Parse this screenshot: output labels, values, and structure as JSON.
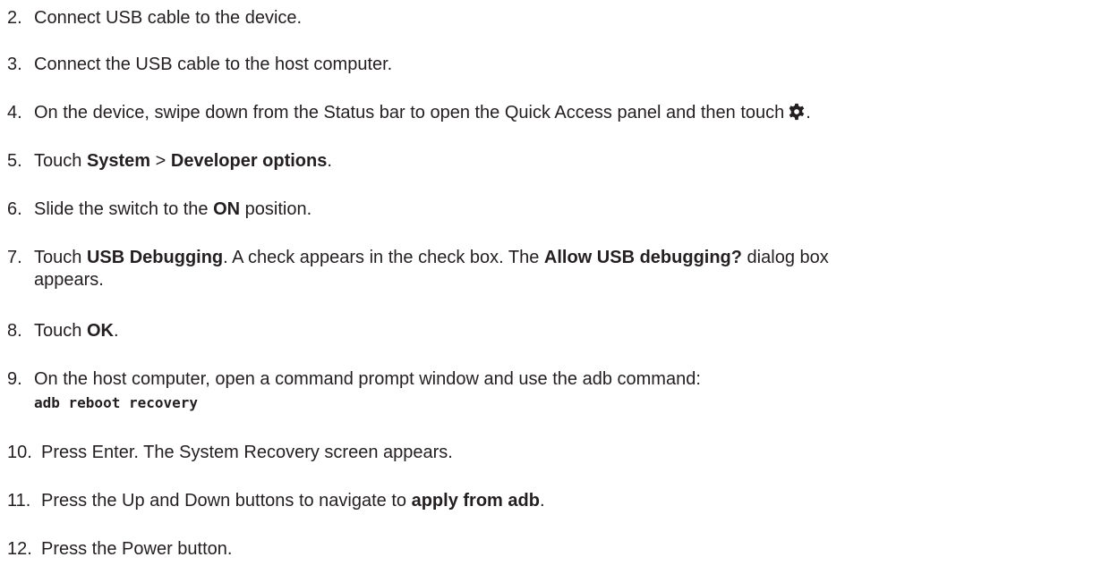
{
  "steps": [
    {
      "num": "2.",
      "text": "Connect USB cable to the device."
    },
    {
      "num": "3.",
      "text": "Connect the USB cable to the host computer."
    },
    {
      "num": "4.",
      "text": "On the device, swipe down from the Status bar to open the Quick Access panel and then touch",
      "icon": "gear-icon",
      "end": "."
    },
    {
      "num": "5.",
      "a": "Touch ",
      "b1": "System",
      "c": " > ",
      "b2": "Developer options",
      "end": "."
    },
    {
      "num": "6.",
      "a": "Slide the switch to the ",
      "b1": "ON",
      "c": " position."
    },
    {
      "num": "7.",
      "a": "Touch ",
      "b1": "USB Debugging",
      "c": ". A check appears in the check box. The ",
      "b2": "Allow USB debugging?",
      "d": " dialog box",
      "cont": "appears."
    },
    {
      "num": "8.",
      "a": "Touch ",
      "b1": "OK",
      "end": "."
    },
    {
      "num": "9.",
      "text": "On the host computer, open a command prompt window and use the adb command:",
      "code": "adb reboot recovery"
    },
    {
      "num": "10.",
      "text": "Press Enter. The System Recovery screen appears."
    },
    {
      "num": "11.",
      "a": "Press the Up and Down buttons to navigate to ",
      "b1": "apply from adb",
      "end": "."
    },
    {
      "num": "12.",
      "text": "Press the Power button."
    }
  ]
}
